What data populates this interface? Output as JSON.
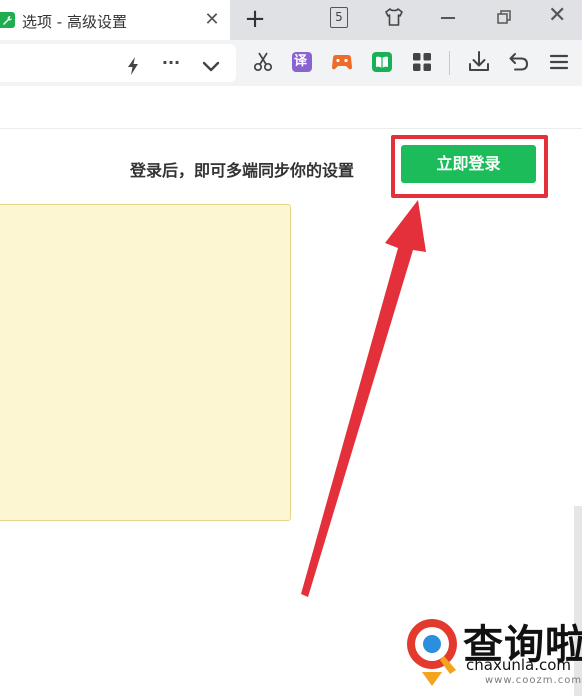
{
  "tab": {
    "title": "选项 - 高级设置",
    "close_glyph": "✕"
  },
  "new_tab_glyph": "+",
  "tab_count": "5",
  "window": {
    "close_glyph": "✕"
  },
  "toolbar": {
    "more_glyph": "···",
    "icons": [
      "lightning-icon",
      "more-icon",
      "chevron-down-icon",
      "scissors-icon",
      "translate-icon",
      "game-icon",
      "book-icon",
      "apps-grid-icon",
      "download-icon",
      "undo-icon",
      "menu-icon"
    ],
    "translate_label": "译"
  },
  "banner": {
    "message": "登录后，即可多端同步你的设置",
    "login_label": "立即登录"
  },
  "colors": {
    "accent_green": "#1dbc5a",
    "highlight_red": "#e3303b",
    "yellow_panel": "#fdf6d3"
  },
  "watermark": {
    "name": "查询啦",
    "domain": "chaxunla.com",
    "sub": "www.coozm.com"
  }
}
